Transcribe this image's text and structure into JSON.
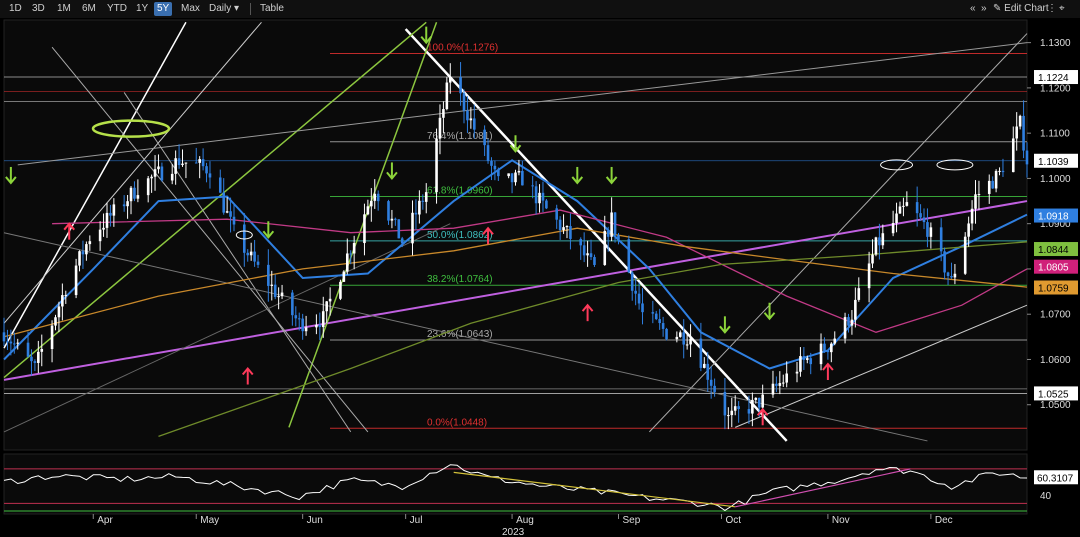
{
  "toolbar": {
    "ranges": [
      "1D",
      "3D",
      "1M",
      "6M",
      "YTD",
      "1Y",
      "5Y",
      "Max"
    ],
    "active_range": "5Y",
    "interval": "Daily",
    "table_label": "Table",
    "edit_chart_label": "Edit Chart",
    "nav_arrows": "«",
    "nav_arrows_right": "»"
  },
  "chart_data": {
    "type": "line",
    "subtype": "candlestick",
    "title": "",
    "xlabel": "2023",
    "ylabel": "",
    "ylim": [
      1.04,
      1.135
    ],
    "y_ticks": [
      1.05,
      1.06,
      1.07,
      1.08,
      1.09,
      1.1,
      1.11,
      1.12,
      1.13
    ],
    "y_tick_labels": [
      "1.0500",
      "1.0600",
      "1.0700",
      "1.0800",
      "1.0900",
      "1.1000",
      "1.1100",
      "1.1200",
      "1.1300"
    ],
    "x_range": [
      "2023-03-06",
      "2023-12-29"
    ],
    "x_months": [
      {
        "label": "Apr",
        "date": "2023-04-01"
      },
      {
        "label": "May",
        "date": "2023-05-01"
      },
      {
        "label": "Jun",
        "date": "2023-06-01"
      },
      {
        "label": "Jul",
        "date": "2023-07-01"
      },
      {
        "label": "Aug",
        "date": "2023-08-01"
      },
      {
        "label": "Sep",
        "date": "2023-09-01"
      },
      {
        "label": "Oct",
        "date": "2023-10-01"
      },
      {
        "label": "Nov",
        "date": "2023-11-01"
      },
      {
        "label": "Dec",
        "date": "2023-12-01"
      }
    ],
    "grid": false,
    "price_path": [
      [
        "2023-03-06",
        1.066
      ],
      [
        "2023-03-15",
        1.058
      ],
      [
        "2023-03-24",
        1.076
      ],
      [
        "2023-03-31",
        1.087
      ],
      [
        "2023-04-14",
        1.098
      ],
      [
        "2023-04-26",
        1.104
      ],
      [
        "2023-05-05",
        1.102
      ],
      [
        "2023-05-12",
        1.088
      ],
      [
        "2023-05-19",
        1.08
      ],
      [
        "2023-05-31",
        1.068
      ],
      [
        "2023-06-07",
        1.069
      ],
      [
        "2023-06-14",
        1.083
      ],
      [
        "2023-06-22",
        1.098
      ],
      [
        "2023-06-30",
        1.086
      ],
      [
        "2023-07-07",
        1.097
      ],
      [
        "2023-07-14",
        1.123
      ],
      [
        "2023-07-21",
        1.111
      ],
      [
        "2023-07-28",
        1.099
      ],
      [
        "2023-08-04",
        1.1
      ],
      [
        "2023-08-11",
        1.093
      ],
      [
        "2023-08-18",
        1.087
      ],
      [
        "2023-08-25",
        1.08
      ],
      [
        "2023-08-30",
        1.091
      ],
      [
        "2023-09-08",
        1.07
      ],
      [
        "2023-09-15",
        1.066
      ],
      [
        "2023-09-22",
        1.065
      ],
      [
        "2023-10-03",
        1.047
      ],
      [
        "2023-10-13",
        1.051
      ],
      [
        "2023-10-24",
        1.059
      ],
      [
        "2023-11-01",
        1.063
      ],
      [
        "2023-11-08",
        1.07
      ],
      [
        "2023-11-15",
        1.085
      ],
      [
        "2023-11-24",
        1.094
      ],
      [
        "2023-11-30",
        1.089
      ],
      [
        "2023-12-07",
        1.077
      ],
      [
        "2023-12-14",
        1.096
      ],
      [
        "2023-12-21",
        1.101
      ],
      [
        "2023-12-27",
        1.112
      ],
      [
        "2023-12-29",
        1.104
      ]
    ],
    "moving_averages": [
      {
        "color": "#2f7fe0",
        "values": [
          [
            "2023-03-06",
            1.06
          ],
          [
            "2023-04-01",
            1.08
          ],
          [
            "2023-04-20",
            1.095
          ],
          [
            "2023-05-10",
            1.096
          ],
          [
            "2023-06-01",
            1.078
          ],
          [
            "2023-06-20",
            1.079
          ],
          [
            "2023-07-15",
            1.095
          ],
          [
            "2023-08-01",
            1.104
          ],
          [
            "2023-08-20",
            1.095
          ],
          [
            "2023-09-10",
            1.08
          ],
          [
            "2023-09-25",
            1.066
          ],
          [
            "2023-10-15",
            1.058
          ],
          [
            "2023-11-01",
            1.062
          ],
          [
            "2023-11-20",
            1.078
          ],
          [
            "2023-12-10",
            1.085
          ],
          [
            "2023-12-29",
            1.092
          ]
        ]
      },
      {
        "color": "#c13a86",
        "values": [
          [
            "2023-03-20",
            1.09
          ],
          [
            "2023-05-10",
            1.091
          ],
          [
            "2023-06-15",
            1.088
          ],
          [
            "2023-07-15",
            1.089
          ],
          [
            "2023-08-15",
            1.093
          ],
          [
            "2023-09-15",
            1.087
          ],
          [
            "2023-10-20",
            1.074
          ],
          [
            "2023-11-15",
            1.066
          ],
          [
            "2023-12-10",
            1.072
          ],
          [
            "2023-12-29",
            1.08
          ]
        ]
      },
      {
        "color": "#c8882a",
        "values": [
          [
            "2023-03-06",
            1.065
          ],
          [
            "2023-04-20",
            1.074
          ],
          [
            "2023-06-01",
            1.08
          ],
          [
            "2023-07-15",
            1.084
          ],
          [
            "2023-08-20",
            1.089
          ],
          [
            "2023-09-20",
            1.085
          ],
          [
            "2023-10-20",
            1.082
          ],
          [
            "2023-11-20",
            1.079
          ],
          [
            "2023-12-29",
            1.076
          ]
        ]
      },
      {
        "color": "#6f8b2a",
        "values": [
          [
            "2023-04-20",
            1.043
          ],
          [
            "2023-06-15",
            1.058
          ],
          [
            "2023-07-20",
            1.068
          ],
          [
            "2023-09-01",
            1.077
          ],
          [
            "2023-10-01",
            1.081
          ],
          [
            "2023-11-10",
            1.083
          ],
          [
            "2023-12-29",
            1.086
          ]
        ]
      }
    ],
    "fib_levels": [
      {
        "label": "100.0%(1.1276)",
        "value": 1.1276,
        "color": "#e03030"
      },
      {
        "label": "76.4%(1.1081)",
        "value": 1.1081,
        "color": "#aaaaaa"
      },
      {
        "label": "61.8%(1.0960)",
        "value": 1.096,
        "color": "#3fbf3f"
      },
      {
        "label": "50.0%(1.0862)",
        "value": 1.0862,
        "color": "#3fbfbf"
      },
      {
        "label": "38.2%(1.0764)",
        "value": 1.0764,
        "color": "#3fbf3f"
      },
      {
        "label": "23.6%(1.0643)",
        "value": 1.0643,
        "color": "#aaaaaa"
      },
      {
        "label": "0.0%(1.0448)",
        "value": 1.0448,
        "color": "#e03030"
      }
    ],
    "price_tags": [
      {
        "label": "1.1224",
        "value": 1.1224,
        "bg": "#ffffff",
        "fg": "#000000"
      },
      {
        "label": "1.1039",
        "value": 1.1039,
        "bg": "#ffffff",
        "fg": "#000000"
      },
      {
        "label": "1.0918",
        "value": 1.0918,
        "bg": "#2f7fe0",
        "fg": "#ffffff"
      },
      {
        "label": "1.0844",
        "value": 1.0844,
        "bg": "#7fbf3f",
        "fg": "#000000"
      },
      {
        "label": "1.0805",
        "value": 1.0805,
        "bg": "#d0207a",
        "fg": "#ffffff"
      },
      {
        "label": "1.0759",
        "value": 1.0759,
        "bg": "#e09a30",
        "fg": "#000000"
      },
      {
        "label": "1.0525",
        "value": 1.0525,
        "bg": "#ffffff",
        "fg": "#000000"
      }
    ],
    "rsi_panel": {
      "ylim": [
        20,
        85
      ],
      "levels": [
        70,
        30
      ],
      "tick_labels": [
        {
          "label": "40",
          "value": 40
        }
      ],
      "last_value_label": "60.3107",
      "last_value": 60.31,
      "values": [
        [
          "2023-03-06",
          55
        ],
        [
          "2023-03-20",
          62
        ],
        [
          "2023-04-10",
          58
        ],
        [
          "2023-04-25",
          61
        ],
        [
          "2023-05-10",
          52
        ],
        [
          "2023-05-31",
          38
        ],
        [
          "2023-06-15",
          57
        ],
        [
          "2023-06-30",
          50
        ],
        [
          "2023-07-14",
          76
        ],
        [
          "2023-07-25",
          60
        ],
        [
          "2023-08-10",
          50
        ],
        [
          "2023-08-25",
          44
        ],
        [
          "2023-09-10",
          36
        ],
        [
          "2023-09-25",
          30
        ],
        [
          "2023-10-03",
          25
        ],
        [
          "2023-10-15",
          43
        ],
        [
          "2023-10-25",
          50
        ],
        [
          "2023-11-05",
          58
        ],
        [
          "2023-11-15",
          70
        ],
        [
          "2023-11-25",
          68
        ],
        [
          "2023-12-07",
          50
        ],
        [
          "2023-12-20",
          66
        ],
        [
          "2023-12-29",
          60
        ]
      ]
    }
  }
}
